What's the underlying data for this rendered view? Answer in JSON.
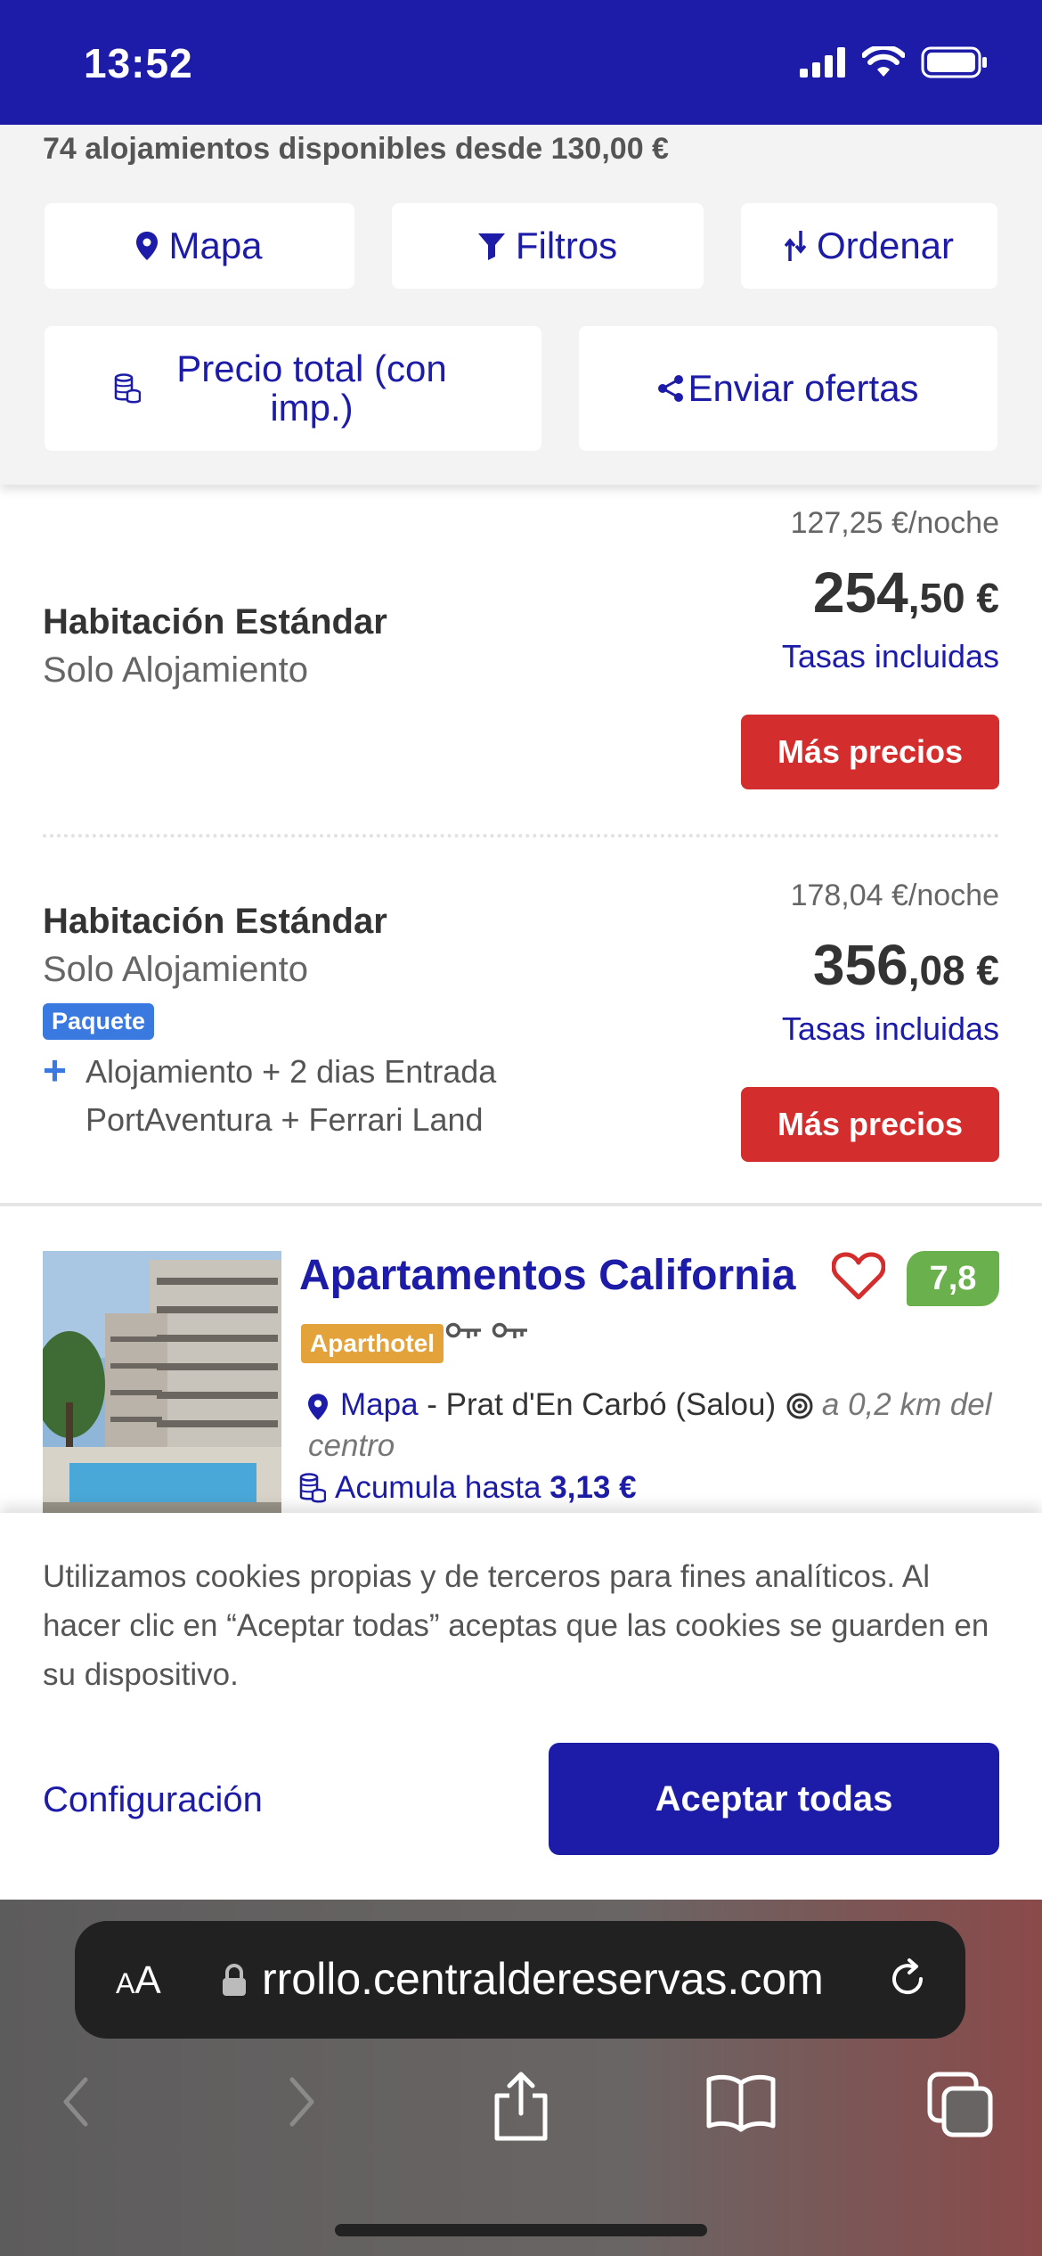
{
  "status": {
    "time": "13:52"
  },
  "summary": {
    "available_text": "74 alojamientos disponibles desde 130,00 €"
  },
  "filters": {
    "map_label": "Mapa",
    "filters_label": "Filtros",
    "sort_label": "Ordenar",
    "total_price_label": "Precio total (con imp.)",
    "send_offers_label": "Enviar ofertas"
  },
  "offers": [
    {
      "per_night": "127,25 €/noche",
      "price_int": "254",
      "price_dec": ",50 €",
      "taxes": "Tasas incluidas",
      "button": "Más precios",
      "room": "Habitación Estándar",
      "board": "Solo Alojamiento"
    },
    {
      "per_night": "178,04 €/noche",
      "price_int": "356",
      "price_dec": ",08 €",
      "taxes": "Tasas incluidas",
      "button": "Más precios",
      "room": "Habitación Estándar",
      "board": "Solo Alojamiento",
      "badge": "Paquete",
      "package_plus": "+",
      "package_text": "Alojamiento + 2 dias Entrada PortAventura + Ferrari Land"
    }
  ],
  "hotel": {
    "name": "Apartamentos California",
    "score": "7,8",
    "category": "Aparthotel",
    "map_link": "Mapa",
    "location": " - Prat d'En Carbó (Salou) ",
    "distance": "a 0,2 km del centro",
    "accumulate_label": "Acumula hasta ",
    "accumulate_value": "3,13 €"
  },
  "cookie": {
    "text": "Utilizamos cookies propias y de terceros para fines analíticos. Al hacer clic en “Aceptar todas” aceptas que las cookies se guarden en su dispositivo.",
    "config_label": "Configuración",
    "accept_label": "Aceptar todas"
  },
  "browser": {
    "aa_small": "A",
    "aa_big": "A",
    "url": "rrollo.centraldereservas.com"
  },
  "colors": {
    "brand": "#1d1ca8",
    "cta_red": "#d42d2d",
    "score_green": "#6ab04c",
    "package_blue": "#3a7ae0",
    "aparthotel_orange": "#e3a23a"
  },
  "icons": [
    "signal-icon",
    "wifi-icon",
    "battery-icon",
    "map-pin-icon",
    "filter-icon",
    "sort-icon",
    "coins-icon",
    "share-icon",
    "heart-icon",
    "key-icon",
    "target-icon",
    "lock-icon",
    "reload-icon",
    "back-icon",
    "forward-icon",
    "share-ios-icon",
    "bookmarks-icon",
    "tabs-icon"
  ]
}
